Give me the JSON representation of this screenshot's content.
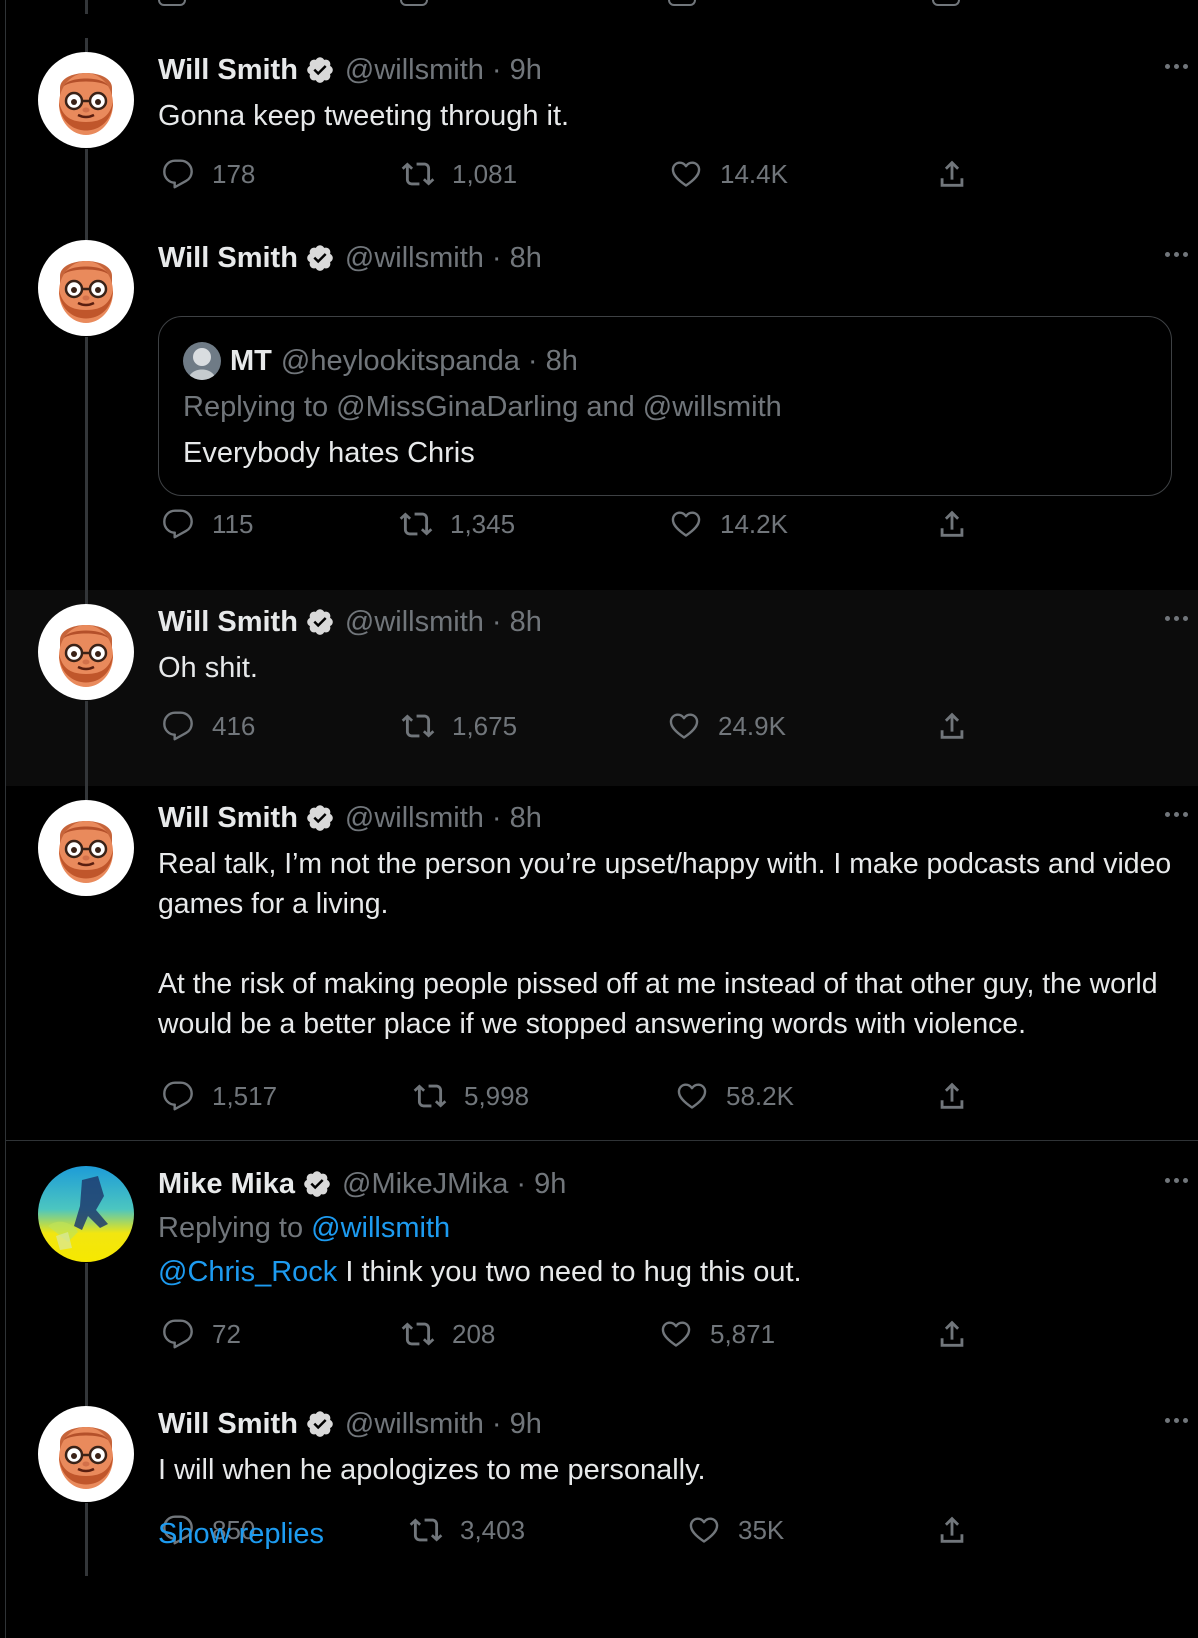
{
  "accent_color": "#1d9bf0",
  "background_color": "#000000",
  "icons": {
    "reply": "reply-icon",
    "retweet": "retweet-icon",
    "like": "heart-icon",
    "share": "share-icon",
    "verified": "verified-badge-icon",
    "more": "more-options-icon"
  },
  "tweets": [
    {
      "name": "Will Smith",
      "handle": "@willsmith",
      "sep": "·",
      "time": "9h",
      "text": "Gonna keep tweeting through it.",
      "stats": {
        "replies": "178",
        "retweets": "1,081",
        "likes": "14.4K"
      }
    },
    {
      "name": "Will Smith",
      "handle": "@willsmith",
      "sep": "·",
      "time": "8h",
      "quote": {
        "name": "MT",
        "handle": "@heylookitspanda",
        "sep": "·",
        "time": "8h",
        "replying_to": "Replying to @MissGinaDarling and @willsmith",
        "text": "Everybody hates Chris"
      },
      "stats": {
        "replies": "115",
        "retweets": "1,345",
        "likes": "14.2K"
      }
    },
    {
      "name": "Will Smith",
      "handle": "@willsmith",
      "sep": "·",
      "time": "8h",
      "text": "Oh shit.",
      "stats": {
        "replies": "416",
        "retweets": "1,675",
        "likes": "24.9K"
      }
    },
    {
      "name": "Will Smith",
      "handle": "@willsmith",
      "sep": "·",
      "time": "8h",
      "text": "Real talk, I’m not the person you’re upset/happy with. I make podcasts and video games for a living.\n\nAt the risk of making people pissed off at me instead of that other guy, the world would be a better place if we stopped answering words with violence.",
      "stats": {
        "replies": "1,517",
        "retweets": "5,998",
        "likes": "58.2K"
      }
    },
    {
      "name": "Mike Mika",
      "handle": "@MikeJMika",
      "sep": "·",
      "time": "9h",
      "replying_label": "Replying to",
      "replying_handle": "@willsmith",
      "mention": "@Chris_Rock",
      "text": " I think you two need to hug this out.",
      "stats": {
        "replies": "72",
        "retweets": "208",
        "likes": "5,871"
      }
    },
    {
      "name": "Will Smith",
      "handle": "@willsmith",
      "sep": "·",
      "time": "9h",
      "text": "I will when he apologizes to me personally.",
      "stats": {
        "replies": "850",
        "retweets": "3,403",
        "likes": "35K"
      }
    }
  ],
  "show_replies": "Show replies"
}
